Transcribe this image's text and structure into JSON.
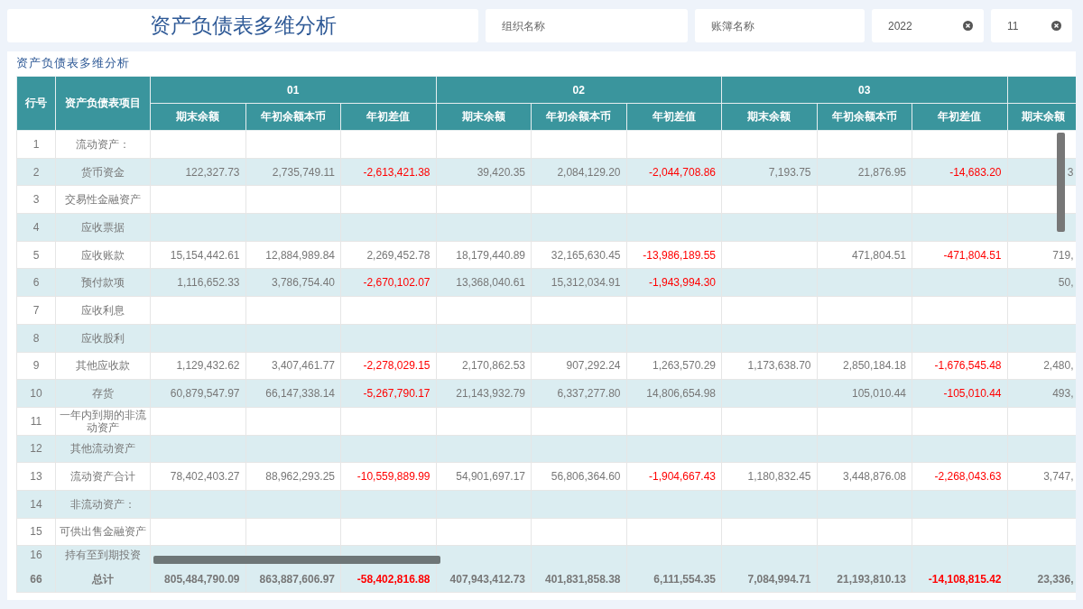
{
  "header": {
    "title": "资产负债表多维分析",
    "filters": [
      {
        "kind": "text",
        "placeholder": "组织名称"
      },
      {
        "kind": "text",
        "placeholder": "账簿名称"
      },
      {
        "kind": "select",
        "value": "2022"
      },
      {
        "kind": "select",
        "value": "11"
      }
    ]
  },
  "report": {
    "title": "资产负债表多维分析",
    "fixed_columns": [
      "行号",
      "资产负债表项目"
    ],
    "column_groups": [
      {
        "label": "01",
        "columns": [
          "期末余额",
          "年初余额本币",
          "年初差值"
        ]
      },
      {
        "label": "02",
        "columns": [
          "期末余额",
          "年初余额本币",
          "年初差值"
        ]
      },
      {
        "label": "03",
        "columns": [
          "期末余额",
          "年初余额本币",
          "年初差值"
        ]
      },
      {
        "columns": [
          "期末余额"
        ]
      }
    ],
    "rows": [
      {
        "no": "1",
        "item": "流动资产：",
        "cells": [
          null,
          null,
          null,
          null,
          null,
          null,
          null,
          null,
          null,
          null
        ]
      },
      {
        "no": "2",
        "item": "货币资金",
        "cells": [
          {
            "text": "122,327.73",
            "negative": false
          },
          {
            "text": "2,735,749.11",
            "negative": false
          },
          {
            "text": "-2,613,421.38",
            "negative": true
          },
          {
            "text": "39,420.35",
            "negative": false
          },
          {
            "text": "2,084,129.20",
            "negative": false
          },
          {
            "text": "-2,044,708.86",
            "negative": true
          },
          {
            "text": "7,193.75",
            "negative": false
          },
          {
            "text": "21,876.95",
            "negative": false
          },
          {
            "text": "-14,683.20",
            "negative": true
          },
          {
            "text": "3",
            "negative": false
          }
        ]
      },
      {
        "no": "3",
        "item": "交易性金融资产",
        "cells": [
          null,
          null,
          null,
          null,
          null,
          null,
          null,
          null,
          null,
          null
        ]
      },
      {
        "no": "4",
        "item": "应收票据",
        "cells": [
          null,
          null,
          null,
          null,
          null,
          null,
          null,
          null,
          null,
          null
        ]
      },
      {
        "no": "5",
        "item": "应收账款",
        "cells": [
          {
            "text": "15,154,442.61",
            "negative": false
          },
          {
            "text": "12,884,989.84",
            "negative": false
          },
          {
            "text": "2,269,452.78",
            "negative": false
          },
          {
            "text": "18,179,440.89",
            "negative": false
          },
          {
            "text": "32,165,630.45",
            "negative": false
          },
          {
            "text": "-13,986,189.55",
            "negative": true
          },
          null,
          {
            "text": "471,804.51",
            "negative": false
          },
          {
            "text": "-471,804.51",
            "negative": true
          },
          {
            "text": "719,",
            "negative": false
          }
        ]
      },
      {
        "no": "6",
        "item": "预付款项",
        "cells": [
          {
            "text": "1,116,652.33",
            "negative": false
          },
          {
            "text": "3,786,754.40",
            "negative": false
          },
          {
            "text": "-2,670,102.07",
            "negative": true
          },
          {
            "text": "13,368,040.61",
            "negative": false
          },
          {
            "text": "15,312,034.91",
            "negative": false
          },
          {
            "text": "-1,943,994.30",
            "negative": true
          },
          null,
          null,
          null,
          {
            "text": "50,",
            "negative": false
          }
        ]
      },
      {
        "no": "7",
        "item": "应收利息",
        "cells": [
          null,
          null,
          null,
          null,
          null,
          null,
          null,
          null,
          null,
          null
        ]
      },
      {
        "no": "8",
        "item": "应收股利",
        "cells": [
          null,
          null,
          null,
          null,
          null,
          null,
          null,
          null,
          null,
          null
        ]
      },
      {
        "no": "9",
        "item": "其他应收款",
        "cells": [
          {
            "text": "1,129,432.62",
            "negative": false
          },
          {
            "text": "3,407,461.77",
            "negative": false
          },
          {
            "text": "-2,278,029.15",
            "negative": true
          },
          {
            "text": "2,170,862.53",
            "negative": false
          },
          {
            "text": "907,292.24",
            "negative": false
          },
          {
            "text": "1,263,570.29",
            "negative": false
          },
          {
            "text": "1,173,638.70",
            "negative": false
          },
          {
            "text": "2,850,184.18",
            "negative": false
          },
          {
            "text": "-1,676,545.48",
            "negative": true
          },
          {
            "text": "2,480,",
            "negative": false
          }
        ]
      },
      {
        "no": "10",
        "item": "存货",
        "cells": [
          {
            "text": "60,879,547.97",
            "negative": false
          },
          {
            "text": "66,147,338.14",
            "negative": false
          },
          {
            "text": "-5,267,790.17",
            "negative": true
          },
          {
            "text": "21,143,932.79",
            "negative": false
          },
          {
            "text": "6,337,277.80",
            "negative": false
          },
          {
            "text": "14,806,654.98",
            "negative": false
          },
          null,
          {
            "text": "105,010.44",
            "negative": false
          },
          {
            "text": "-105,010.44",
            "negative": true
          },
          {
            "text": "493,",
            "negative": false
          }
        ]
      },
      {
        "no": "11",
        "item": "一年内到期的非流动资产",
        "cells": [
          null,
          null,
          null,
          null,
          null,
          null,
          null,
          null,
          null,
          null
        ]
      },
      {
        "no": "12",
        "item": "其他流动资产",
        "cells": [
          null,
          null,
          null,
          null,
          null,
          null,
          null,
          null,
          null,
          null
        ]
      },
      {
        "no": "13",
        "item": "流动资产合计",
        "cells": [
          {
            "text": "78,402,403.27",
            "negative": false
          },
          {
            "text": "88,962,293.25",
            "negative": false
          },
          {
            "text": "-10,559,889.99",
            "negative": true
          },
          {
            "text": "54,901,697.17",
            "negative": false
          },
          {
            "text": "56,806,364.60",
            "negative": false
          },
          {
            "text": "-1,904,667.43",
            "negative": true
          },
          {
            "text": "1,180,832.45",
            "negative": false
          },
          {
            "text": "3,448,876.08",
            "negative": false
          },
          {
            "text": "-2,268,043.63",
            "negative": true
          },
          {
            "text": "3,747,",
            "negative": false
          }
        ]
      },
      {
        "no": "14",
        "item": "非流动资产：",
        "cells": [
          null,
          null,
          null,
          null,
          null,
          null,
          null,
          null,
          null,
          null
        ]
      },
      {
        "no": "15",
        "item": "可供出售金融资产",
        "cells": [
          null,
          null,
          null,
          null,
          null,
          null,
          null,
          null,
          null,
          null
        ]
      },
      {
        "no": "16",
        "item": "持有至到期投资",
        "cells": [
          null,
          null,
          null,
          null,
          null,
          null,
          null,
          null,
          null,
          null
        ]
      }
    ],
    "total": {
      "no": "66",
      "item": "总计",
      "cells": [
        {
          "text": "805,484,790.09",
          "negative": false
        },
        {
          "text": "863,887,606.97",
          "negative": false
        },
        {
          "text": "-58,402,816.88",
          "negative": true
        },
        {
          "text": "407,943,412.73",
          "negative": false
        },
        {
          "text": "401,831,858.38",
          "negative": false
        },
        {
          "text": "6,111,554.35",
          "negative": false
        },
        {
          "text": "7,084,994.71",
          "negative": false
        },
        {
          "text": "21,193,810.13",
          "negative": false
        },
        {
          "text": "-14,108,815.42",
          "negative": true
        },
        {
          "text": "23,336,",
          "negative": false
        }
      ]
    }
  }
}
